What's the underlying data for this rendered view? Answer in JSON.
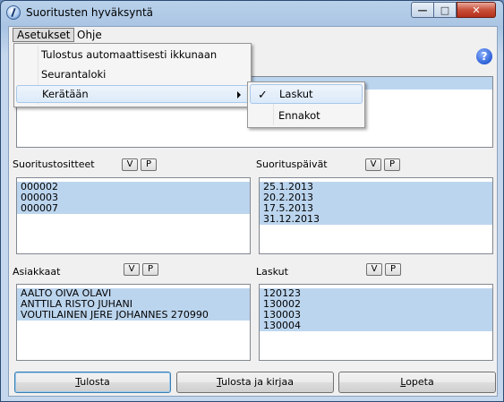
{
  "window": {
    "title": "Suoritusten hyväksyntä"
  },
  "menubar": {
    "settings": "Asetukset",
    "help": "Ohje"
  },
  "settings_menu": {
    "items": [
      {
        "label": "Tulostus automaattisesti ikkunaan"
      },
      {
        "label": "Seurantaloki"
      },
      {
        "label": "Kerätään"
      }
    ]
  },
  "collect_submenu": {
    "items": [
      {
        "label": "Laskut",
        "checked": true
      },
      {
        "label": "Ennakot",
        "checked": false
      }
    ]
  },
  "sections": {
    "suoritustositteet": {
      "label": "Suoritustositteet",
      "items": [
        "000002",
        "000003",
        "000007"
      ]
    },
    "suorituspaivat": {
      "label": "Suorituspäivät",
      "items": [
        "25.1.2013",
        "20.2.2013",
        "17.5.2013",
        "31.12.2013"
      ]
    },
    "asiakkaat": {
      "label": "Asiakkaat",
      "items": [
        "AALTO OIVA OLAVI",
        "ANTTILA RISTO JUHANI",
        "VOUTILAINEN JERE JOHANNES 270990"
      ]
    },
    "laskut": {
      "label": "Laskut",
      "items": [
        "120123",
        "130002",
        "130003",
        "130004"
      ]
    }
  },
  "vp_buttons": {
    "v": "V",
    "p": "P"
  },
  "buttons": {
    "print": {
      "prefix": "",
      "accel": "T",
      "rest": "ulosta"
    },
    "print_and_book": {
      "prefix": "",
      "accel": "T",
      "rest": "ulosta ja kirjaa"
    },
    "exit": {
      "prefix": "",
      "accel": "L",
      "rest": "opeta"
    }
  },
  "colors": {
    "selection": "#bcd5ee",
    "titlebar": "#b9d1ea"
  }
}
